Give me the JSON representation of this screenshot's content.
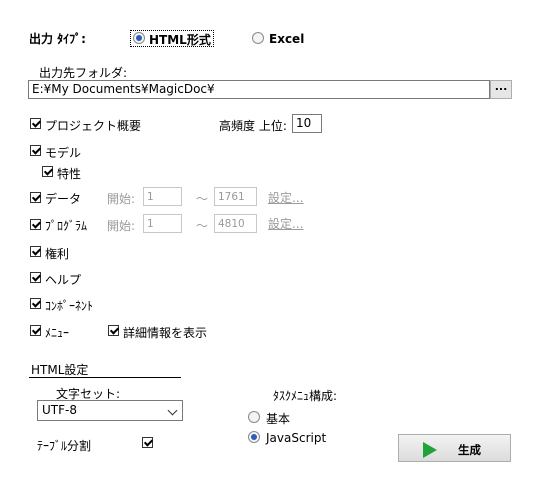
{
  "output_type": {
    "label": "出力 ﾀｲﾌﾟ:",
    "html_option": "HTML形式",
    "excel_option": "Excel",
    "selected": "html"
  },
  "output_folder": {
    "label": "出力先フォルダ:",
    "value": "E:¥My Documents¥MagicDoc¥",
    "browse_label": "..."
  },
  "project_overview": {
    "label": "プロジェクト概要",
    "checked": true
  },
  "top_frequency": {
    "label": "高頻度 上位:",
    "value": "10"
  },
  "model": {
    "label": "モデル",
    "checked": true
  },
  "characteristics": {
    "label": "特性",
    "checked": true
  },
  "data": {
    "label": "データ",
    "checked": true,
    "start_label": "開始:",
    "start_value": "1",
    "tilde": "～",
    "end_value": "1761",
    "settings_label": "設定..."
  },
  "program": {
    "label": "ﾌﾟﾛｸﾞﾗﾑ",
    "checked": true,
    "start_label": "開始:",
    "start_value": "1",
    "tilde": "～",
    "end_value": "4810",
    "settings_label": "設定..."
  },
  "rights": {
    "label": "権利",
    "checked": true
  },
  "help": {
    "label": "ヘルプ",
    "checked": true
  },
  "component": {
    "label": "ｺﾝﾎﾟｰﾈﾝﾄ",
    "checked": true
  },
  "menu": {
    "label": "ﾒﾆｭｰ",
    "checked": true
  },
  "show_details": {
    "label": "詳細情報を表示",
    "checked": true
  },
  "html_settings": {
    "section_title": "HTML設定",
    "charset_label": "文字セット:",
    "charset_value": "UTF-8",
    "table_split_label": "ﾃｰﾌﾞﾙ分割",
    "table_split_checked": true
  },
  "task_menu": {
    "label": "ﾀｽｸﾒﾆｭ構成:",
    "option_basic": "基本",
    "option_javascript": "JavaScript",
    "selected": "javascript"
  },
  "generate_button": {
    "label": "生成",
    "icon": "play-icon",
    "icon_color": "#22a33a"
  },
  "colors": {
    "accent": "#2b5fb6",
    "disabled_text": "#9a9a9a"
  }
}
